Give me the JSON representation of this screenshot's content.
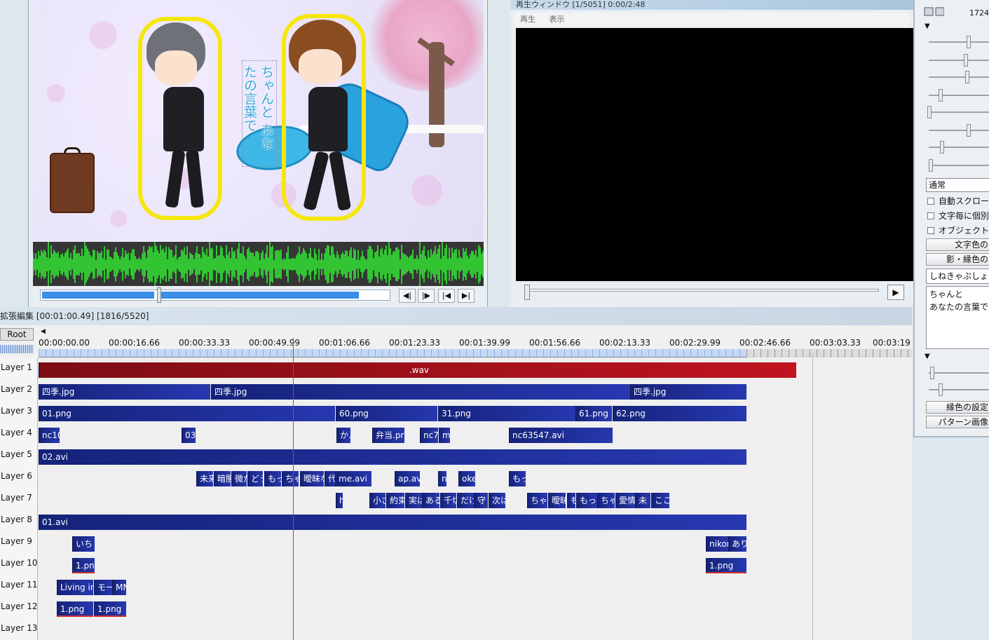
{
  "preview": {
    "lyrics": "ちゃんと\nあなたの言葉で",
    "transport": {
      "prev_frame": "◀|",
      "next_frame": "|▶",
      "to_start": "|◀",
      "to_end": "▶|"
    },
    "seek_progress": 0.33
  },
  "playback": {
    "title": "再生ウィンドウ [1/5051] 0:00/2:48",
    "menu": [
      "再生",
      "表示"
    ],
    "play_button": "▶",
    "seek_progress": 0.0
  },
  "settings": {
    "top_value": "1724",
    "blend_mode": "通常",
    "checkboxes": [
      "自動スクロール",
      "文字毎に個別",
      "オブジェクト"
    ],
    "buttons_top": [
      "文字色の",
      "影・縁色の"
    ],
    "font": "しねきゃぷしょん",
    "text": "ちゃんと\nあなたの言葉で",
    "buttons_bottom": [
      "縁色の設定",
      "パターン画像"
    ]
  },
  "timeline": {
    "title": "拡張編集 [00:01:00.49] [1816/5520]",
    "root_tab": "Root",
    "scroll_arrow": "◀",
    "ticks": [
      "00:00:00.00",
      "00:00:16.66",
      "00:00:33.33",
      "00:00:49.99",
      "00:01:06.66",
      "00:01:23.33",
      "00:01:39.99",
      "00:01:56.66",
      "00:02:13.33",
      "00:02:29.99",
      "00:02:46.66",
      "00:03:03.33",
      "00:03:19"
    ],
    "layers": [
      {
        "name": "Layer  1",
        "clips": [
          {
            "label": ".wav",
            "type": "audio"
          }
        ]
      },
      {
        "name": "Layer  2",
        "clips": [
          {
            "label": "四季.jpg"
          },
          {
            "label": "四季.jpg"
          },
          {
            "label": "四季.jpg"
          }
        ]
      },
      {
        "name": "Layer  3",
        "clips": [
          {
            "label": "01.png"
          },
          {
            "label": "60.png"
          },
          {
            "label": "31.png"
          },
          {
            "label": "61.png"
          },
          {
            "label": "62.png"
          }
        ]
      },
      {
        "name": "Layer  4",
        "clips": [
          {
            "label": "nc10"
          },
          {
            "label": "03."
          },
          {
            "label": "か."
          },
          {
            "label": "弁当.pr"
          },
          {
            "label": "nc7"
          },
          {
            "label": "m"
          },
          {
            "label": "nc63547.avi"
          }
        ]
      },
      {
        "name": "Layer  5",
        "clips": [
          {
            "label": "02.avi"
          }
        ]
      },
      {
        "name": "Layer  6",
        "clips": [
          {
            "label": "未来"
          },
          {
            "label": "暗闇"
          },
          {
            "label": "微か"
          },
          {
            "label": "どう"
          },
          {
            "label": "もっ"
          },
          {
            "label": "ちゃ"
          },
          {
            "label": "曖昧な"
          },
          {
            "label": "代"
          },
          {
            "label": "me.avi"
          },
          {
            "label": "ap.avi"
          },
          {
            "label": "n"
          },
          {
            "label": "oke"
          },
          {
            "label": "もっ"
          }
        ]
      },
      {
        "name": "Layer  7",
        "clips": [
          {
            "label": "h"
          },
          {
            "label": "小さ"
          },
          {
            "label": "約束"
          },
          {
            "label": "実は"
          },
          {
            "label": "ある"
          },
          {
            "label": "千切"
          },
          {
            "label": "だけ"
          },
          {
            "label": "守"
          },
          {
            "label": "次は"
          },
          {
            "label": "ちゃ"
          },
          {
            "label": "曖昧"
          },
          {
            "label": "も"
          },
          {
            "label": "もっ"
          },
          {
            "label": "ちゃ"
          },
          {
            "label": "愛情"
          },
          {
            "label": "未"
          },
          {
            "label": "ここ"
          }
        ]
      },
      {
        "name": "Layer  8",
        "clips": [
          {
            "label": "01.avi"
          }
        ]
      },
      {
        "name": "Layer  9",
        "clips": [
          {
            "label": "いち"
          },
          {
            "label": "nikor"
          },
          {
            "label": "あり"
          }
        ]
      },
      {
        "name": "Layer 10",
        "clips": [
          {
            "label": "1.png"
          },
          {
            "label": "1.png"
          }
        ]
      },
      {
        "name": "Layer 11",
        "clips": [
          {
            "label": "Living in"
          },
          {
            "label": "モー"
          },
          {
            "label": "MN"
          }
        ]
      },
      {
        "name": "Layer 12",
        "clips": [
          {
            "label": "1.png"
          },
          {
            "label": "1.png"
          }
        ]
      },
      {
        "name": "Layer 13",
        "clips": []
      }
    ]
  },
  "colors": {
    "audio_clip": "#b5121b",
    "video_clip": "#1f2f9c",
    "playhead": "#d23434",
    "waveform": "#33e833"
  }
}
